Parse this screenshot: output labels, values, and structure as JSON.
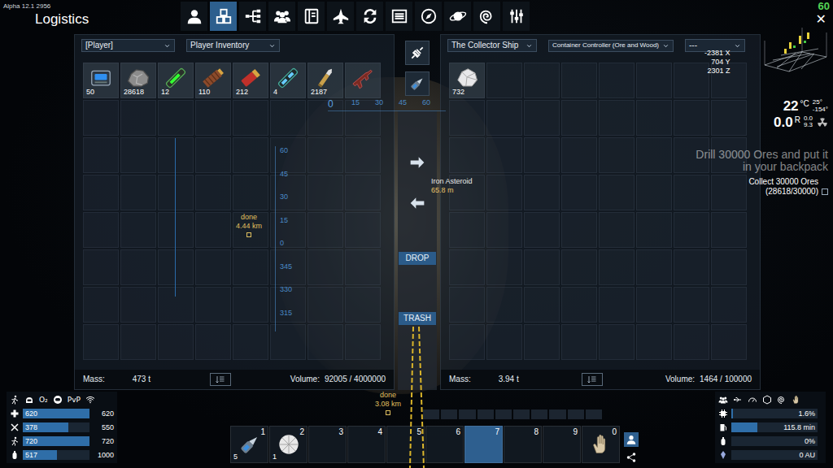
{
  "version": "Alpha 12.1 2956",
  "window": {
    "title": "Logistics",
    "fps": "60",
    "close": "✕"
  },
  "tabs": [
    {
      "kind": "player",
      "selected": false
    },
    {
      "kind": "logistics",
      "selected": true
    },
    {
      "kind": "tree",
      "selected": false
    },
    {
      "kind": "faction",
      "selected": false
    },
    {
      "kind": "book",
      "selected": false
    },
    {
      "kind": "ship",
      "selected": false
    },
    {
      "kind": "exchange",
      "selected": false
    },
    {
      "kind": "list",
      "selected": false
    },
    {
      "kind": "compass",
      "selected": false
    },
    {
      "kind": "planet",
      "selected": false
    },
    {
      "kind": "galaxy",
      "selected": false
    },
    {
      "kind": "sliders",
      "selected": false
    }
  ],
  "left_panel": {
    "source": "[Player]",
    "target": "Player Inventory",
    "items": [
      {
        "kind": "battery",
        "count": "50"
      },
      {
        "kind": "ore",
        "count": "28618"
      },
      {
        "kind": "rod",
        "count": "12"
      },
      {
        "kind": "ammo",
        "count": "110"
      },
      {
        "kind": "shell",
        "count": "212"
      },
      {
        "kind": "tube",
        "count": "4"
      },
      {
        "kind": "bullet",
        "count": "2187"
      },
      {
        "kind": "rifle"
      }
    ],
    "mass_label": "Mass:",
    "mass": "473 t",
    "volume_label": "Volume:",
    "volume": "92005 / 4000000"
  },
  "right_panel": {
    "source": "The Collector Ship",
    "target": "Container Controller (Ore and Wood)",
    "filter": "---",
    "items": [
      {
        "kind": "crystal",
        "count": "732"
      }
    ],
    "mass_label": "Mass:",
    "mass": "3.94 t",
    "volume_label": "Volume:",
    "volume": "1464 / 100000"
  },
  "transfer": {
    "drop": "DROP",
    "trash": "TRASH"
  },
  "hud": {
    "target": {
      "name": "Iron Asteroid",
      "distance": "65.8 m"
    },
    "waypoints": [
      {
        "label": "done",
        "distance": "4.44 km"
      },
      {
        "label": "done",
        "distance": "3.08 km"
      }
    ],
    "compass_h": [
      "0",
      "15",
      "30",
      "45",
      "60"
    ],
    "compass_v": [
      "60",
      "45",
      "30",
      "15",
      "0",
      "345",
      "330",
      "315"
    ],
    "coords": [
      "-2381 X",
      "704 Y",
      "2301 Z"
    ],
    "temperature": "22",
    "temp_unit": "°C",
    "temp_range": [
      "25°",
      "-154°"
    ],
    "radiation": "0.0",
    "rad_unit": "R",
    "rad_range": [
      "0.0",
      "9.3"
    ]
  },
  "mission": {
    "title": "Drill 30000 Ores and put it in your backpack",
    "task": "Collect 30000 Ores",
    "progress": "(28618/30000)",
    "done": false
  },
  "stats": {
    "status_icons": [
      {
        "kind": "runner"
      },
      {
        "kind": "helmet"
      },
      {
        "kind": "label",
        "label": "O₂"
      },
      {
        "kind": "suit"
      },
      {
        "kind": "label",
        "label": "PvP"
      },
      {
        "kind": "signal"
      }
    ],
    "bars": [
      {
        "kind": "health",
        "value": "620",
        "max": "620",
        "level": 1
      },
      {
        "kind": "food",
        "value": "378",
        "max": "550",
        "level": 0.687
      },
      {
        "kind": "stamina",
        "value": "720",
        "max": "720",
        "level": 1
      },
      {
        "kind": "oxygen",
        "value": "517",
        "max": "1000",
        "level": 0.517
      }
    ]
  },
  "hotbar": {
    "slots": [
      {
        "key": "1",
        "kind": "drill",
        "count": "5",
        "selected": false
      },
      {
        "key": "2",
        "kind": "dome",
        "count": "1",
        "selected": false
      },
      {
        "key": "3",
        "selected": false
      },
      {
        "key": "4",
        "selected": false
      },
      {
        "key": "5",
        "selected": false
      },
      {
        "key": "6",
        "selected": false
      },
      {
        "key": "7",
        "selected": true
      },
      {
        "key": "8",
        "selected": false
      },
      {
        "key": "9",
        "selected": false
      },
      {
        "key": "0",
        "kind": "hand",
        "selected": false
      }
    ]
  },
  "ship": {
    "icons": [
      {
        "kind": "faction"
      },
      {
        "kind": "usb"
      },
      {
        "kind": "gauge"
      },
      {
        "kind": "hex"
      },
      {
        "kind": "galaxy"
      },
      {
        "kind": "hand"
      }
    ],
    "bars": [
      {
        "kind": "cpu",
        "text": "1.6%",
        "level": 0.016
      },
      {
        "kind": "fuel",
        "text": "115.8 min",
        "level": 0.3
      },
      {
        "kind": "oxygen",
        "text": "0%",
        "level": 0
      },
      {
        "kind": "warp",
        "text": "0 AU",
        "level": 0
      }
    ]
  }
}
